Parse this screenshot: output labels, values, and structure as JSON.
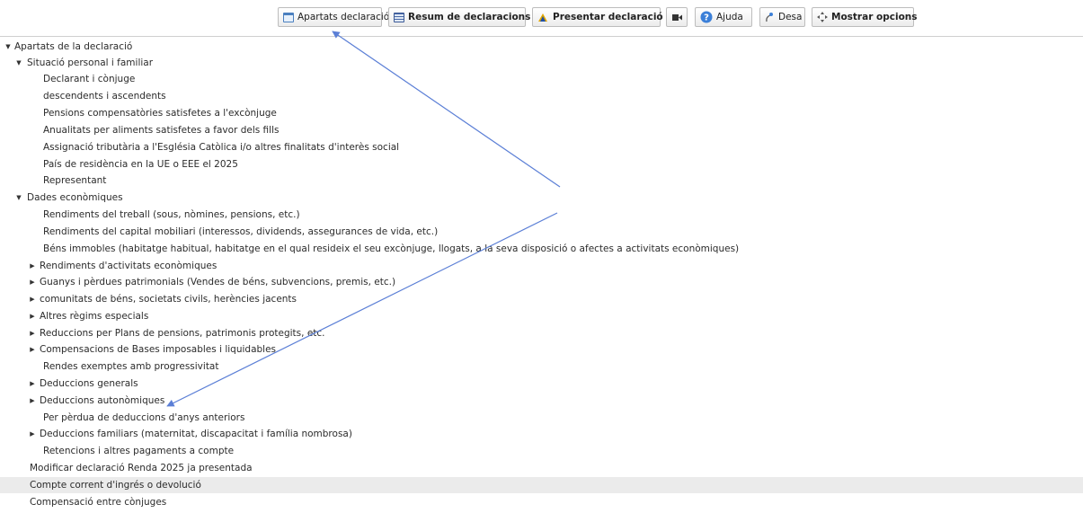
{
  "toolbar": {
    "apartats": "Apartats declaració",
    "resum": "Resum de declaracions",
    "presentar": "Presentar declaració",
    "ajuda": "Ajuda",
    "desa": "Desa",
    "mostrar": "Mostrar opcions"
  },
  "tree": {
    "root": "Apartats de la declaració",
    "situacio": {
      "label": "Situació personal i familiar",
      "items": [
        "Declarant i cònjuge",
        "descendents i ascendents",
        "Pensions compensatòries satisfetes a l'excònjuge",
        "Anualitats per aliments satisfetes a favor dels fills",
        "Assignació tributària a l'Església Catòlica i/o altres finalitats d'interès social",
        "País de residència en la UE o EEE el 2025",
        "Representant"
      ]
    },
    "dades": {
      "label": "Dades econòmiques",
      "items": [
        "Rendiments del treball (sous, nòmines, pensions, etc.)",
        "Rendiments del capital mobiliari (interessos, dividends, assegurances de vida, etc.)",
        "Béns immobles (habitatge habitual, habitatge en el qual resideix el seu excònjuge, llogats, a la seva disposició o afectes a activitats econòmiques)",
        "Rendiments d'activitats econòmiques",
        "Guanys i pèrdues patrimonials (Vendes de béns, subvencions, premis, etc.)",
        "comunitats de béns, societats civils, herències jacents",
        "Altres règims especials",
        "Reduccions per Plans de pensions, patrimonis protegits, etc.",
        "Compensacions de Bases imposables i liquidables",
        "Rendes exemptes amb progressivitat",
        "Deduccions generals",
        "Deduccions autonòmiques",
        "Per pèrdua de deduccions d'anys anteriors",
        "Deduccions familiars (maternitat, discapacitat i família nombrosa)",
        "Retencions i altres pagaments a compte"
      ]
    },
    "tail": [
      "Modificar declaració Renda 2025 ja presentada",
      "Compte corrent d'ingrés o devolució",
      "Compensació entre cònjuges"
    ]
  },
  "colors": {
    "text": "#2b2b2b",
    "row_highlight": "#ebebeb",
    "annotation_arrow": "#5b7fd6"
  }
}
